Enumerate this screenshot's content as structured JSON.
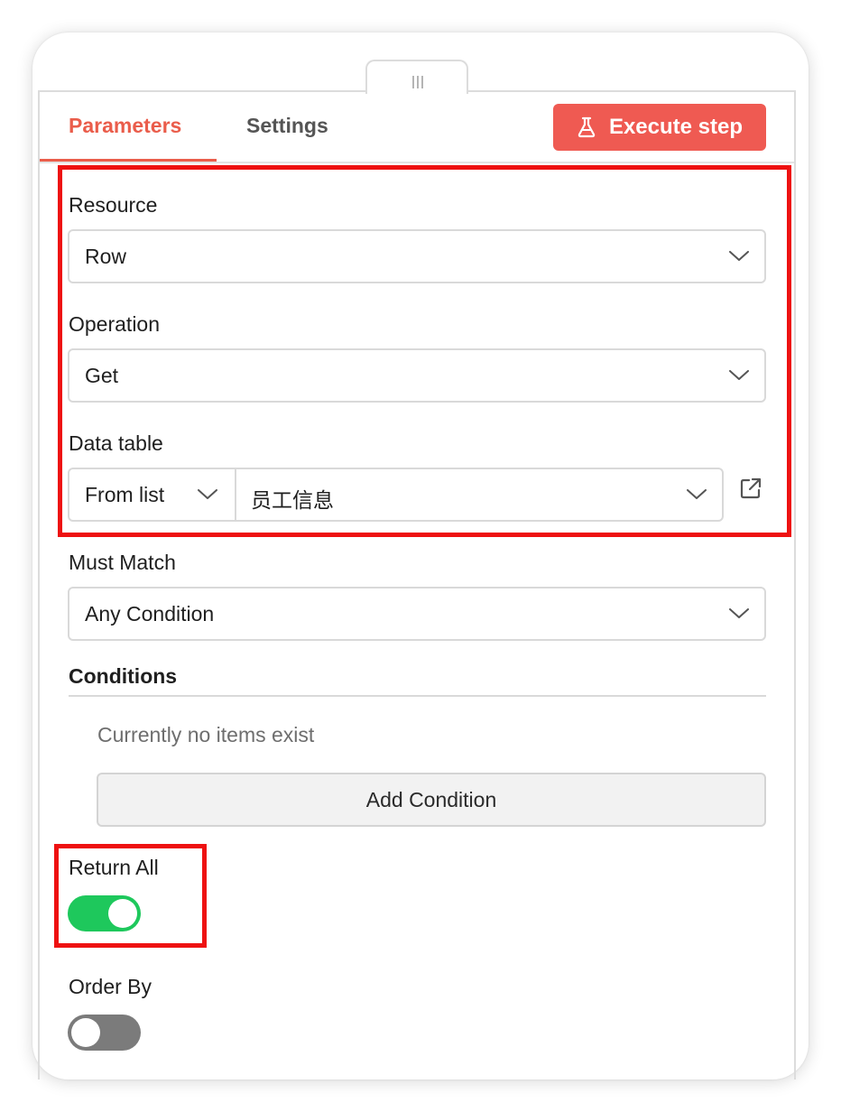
{
  "tabs": {
    "parameters": "Parameters",
    "settings": "Settings",
    "active": "Parameters"
  },
  "toolbar": {
    "execute_label": "Execute step",
    "execute_icon": "flask-icon"
  },
  "fields": {
    "resource": {
      "label": "Resource",
      "value": "Row"
    },
    "operation": {
      "label": "Operation",
      "value": "Get"
    },
    "data_table": {
      "label": "Data table",
      "mode": "From list",
      "value": "员工信息",
      "link_icon": "external-link-icon"
    },
    "must_match": {
      "label": "Must Match",
      "value": "Any Condition"
    }
  },
  "conditions": {
    "title": "Conditions",
    "empty_text": "Currently no items exist",
    "add_label": "Add Condition"
  },
  "return_all": {
    "label": "Return All",
    "enabled": true
  },
  "order_by": {
    "label": "Order By",
    "enabled": false
  },
  "colors": {
    "accent": "#ea5d4b",
    "execute_button": "#ef5a52",
    "toggle_on": "#1ec85c",
    "toggle_off": "#7b7b7b",
    "highlight": "#ee1111"
  }
}
